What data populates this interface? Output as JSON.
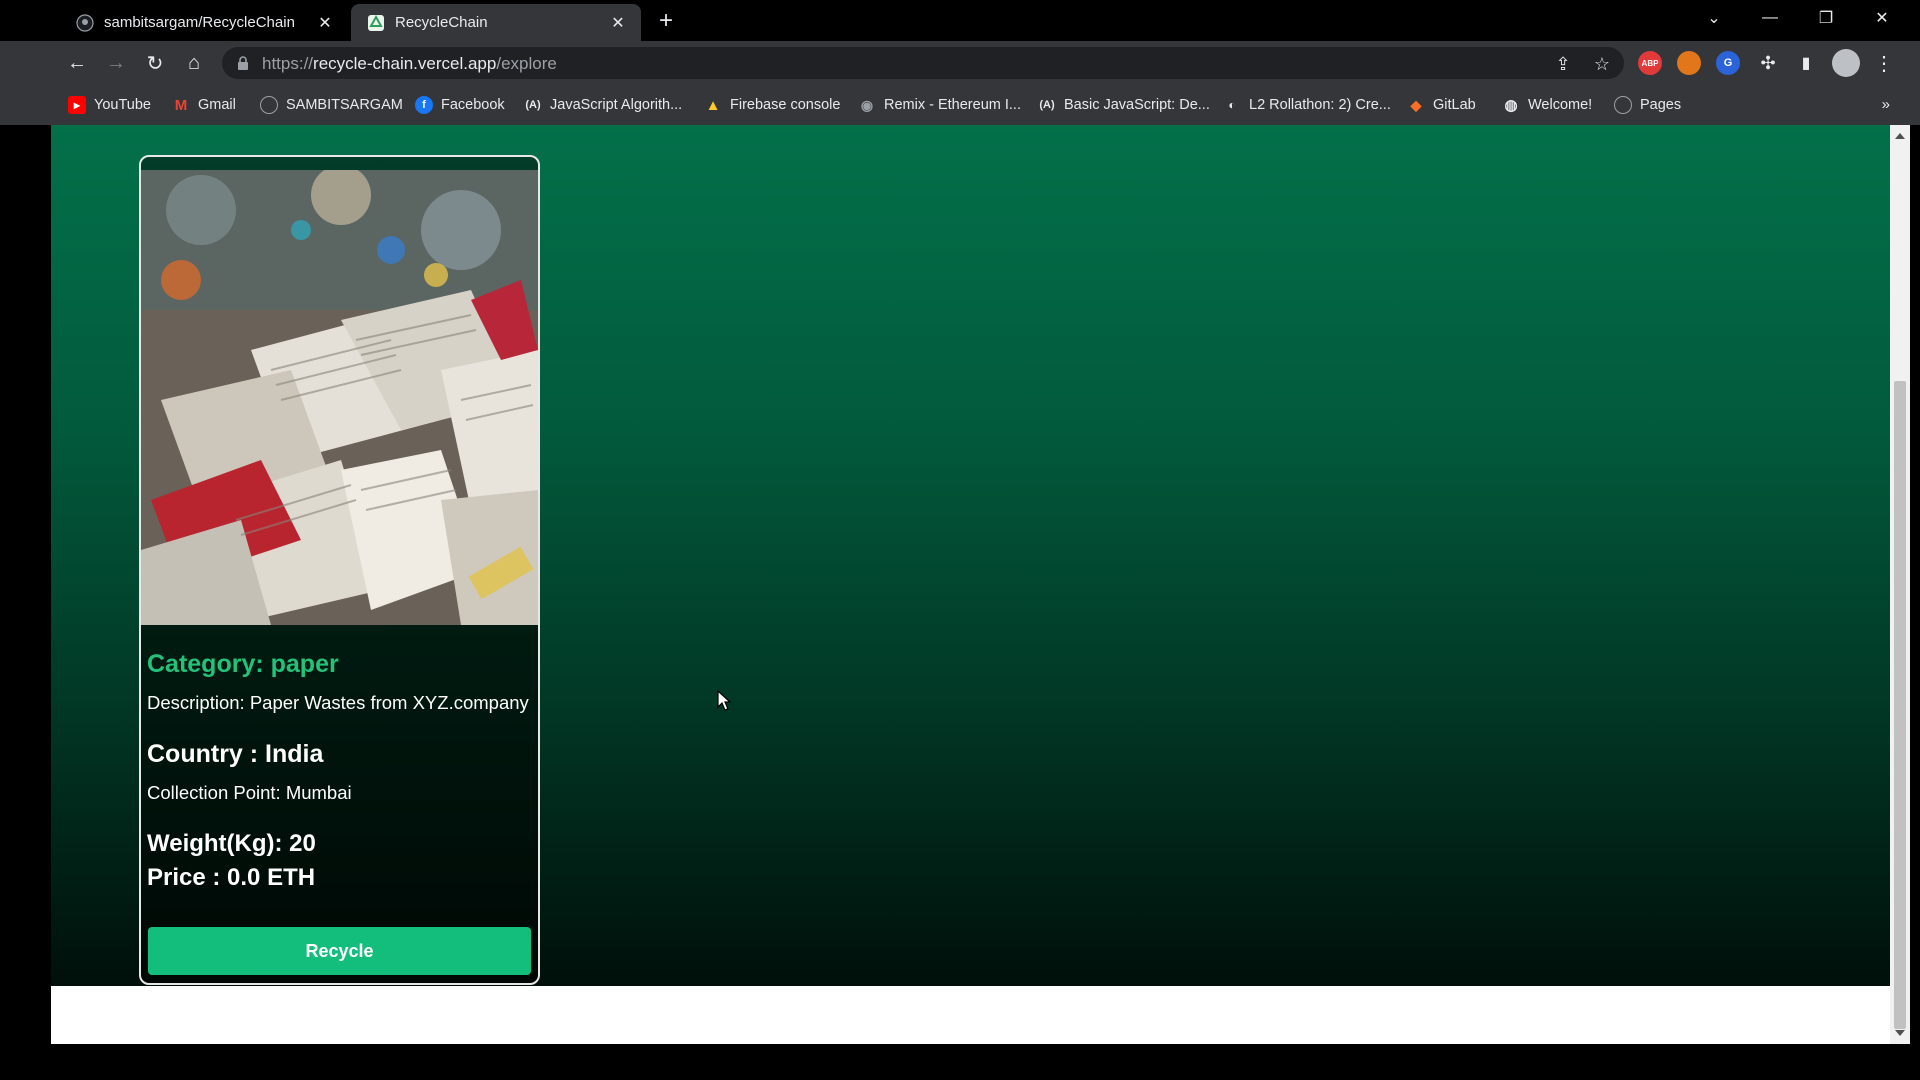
{
  "browser": {
    "tabs": [
      {
        "title": "sambitsargam/RecycleChain",
        "active": false,
        "icon": "github-icon"
      },
      {
        "title": "RecycleChain",
        "active": true,
        "icon": "recyclechain-favicon-icon"
      }
    ],
    "url": {
      "scheme": "https://",
      "host": "recycle-chain.vercel.app",
      "path": "/explore"
    },
    "bookmarks": [
      {
        "label": "YouTube",
        "icon": "youtube-icon"
      },
      {
        "label": "Gmail",
        "icon": "gmail-icon"
      },
      {
        "label": "SAMBITSARGAM",
        "icon": "github-icon"
      },
      {
        "label": "Facebook",
        "icon": "facebook-icon"
      },
      {
        "label": "JavaScript Algorith...",
        "icon": "freecodecamp-icon"
      },
      {
        "label": "Firebase console",
        "icon": "firebase-icon"
      },
      {
        "label": "Remix - Ethereum I...",
        "icon": "remix-icon"
      },
      {
        "label": "Basic JavaScript: De...",
        "icon": "freecodecamp-icon"
      },
      {
        "label": "L2 Rollathon: 2) Cre...",
        "icon": "devfolio-icon"
      },
      {
        "label": "GitLab",
        "icon": "gitlab-icon"
      },
      {
        "label": "Welcome!",
        "icon": "globe-icon"
      },
      {
        "label": "Pages",
        "icon": "github-icon"
      }
    ],
    "extensions": [
      {
        "label": "ABP",
        "icon": "adblock-plus-icon",
        "color": "#e23a3a"
      },
      {
        "label": "",
        "icon": "metamask-icon",
        "color": "#e2761b"
      },
      {
        "label": "G",
        "icon": "grammarly-icon",
        "color": "#2b63d8"
      }
    ]
  },
  "card": {
    "image_alt": "Pile of paper waste and newspapers",
    "category": "Category: paper",
    "description": "Description: Paper Wastes from XYZ.company",
    "country": "Country : India",
    "collection_point": "Collection Point: Mumbai",
    "weight": "Weight(Kg): 20",
    "price": "Price : 0.0 ETH",
    "button_label": "Recycle"
  },
  "colors": {
    "accent": "#13bd7c",
    "category_text": "#22c27a",
    "page_gradient_top": "#03704a",
    "page_gradient_bottom": "#000f0a"
  }
}
